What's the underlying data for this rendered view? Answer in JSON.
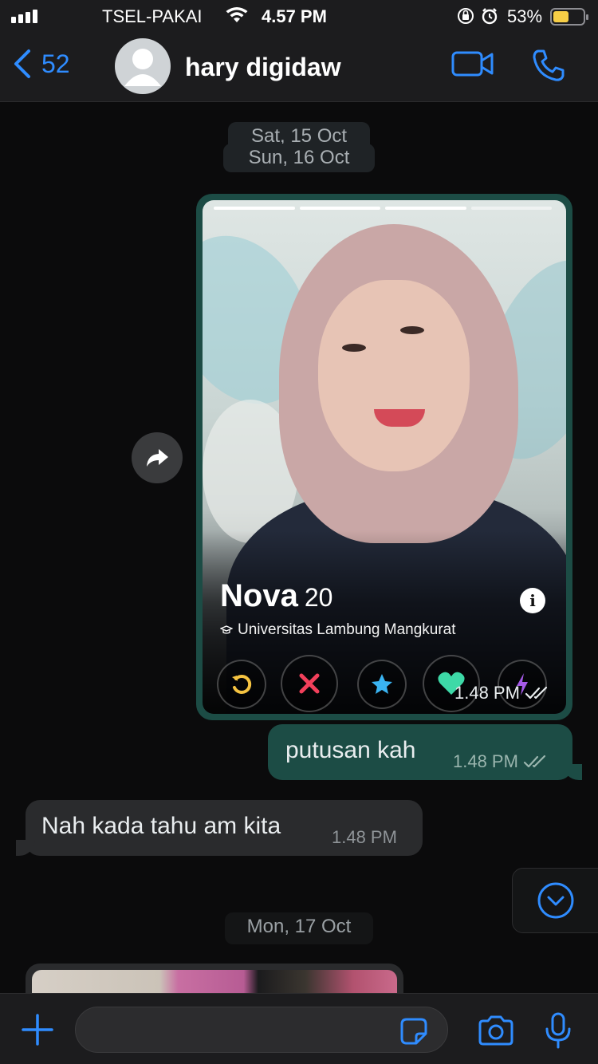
{
  "status_bar": {
    "carrier": "TSEL-PAKAI",
    "time": "4.57 PM",
    "battery_percent": "53%",
    "battery_level": 0.53,
    "icons": [
      "signal-icon",
      "wifi-icon",
      "orientation-lock-icon",
      "alarm-icon",
      "battery-icon"
    ]
  },
  "header": {
    "back_count": "52",
    "contact_name": "hary digidaw",
    "accent_color": "#2f8cff"
  },
  "dates": {
    "first": "Sat, 15 Oct",
    "second": "Sun, 16 Oct",
    "third": "Mon, 17 Oct"
  },
  "image_message": {
    "profile_name": "Nova",
    "profile_age": "20",
    "school": "Universitas Lambung Mangkurat",
    "time": "1.48 PM",
    "actions": [
      "rewind-icon",
      "nope-icon",
      "super-like-icon",
      "like-icon",
      "boost-icon"
    ]
  },
  "messages": [
    {
      "direction": "outgoing",
      "text": "putusan kah",
      "time": "1.48 PM",
      "status": "read"
    },
    {
      "direction": "incoming",
      "text": "Nah kada tahu am kita",
      "time": "1.48 PM"
    }
  ],
  "composer": {
    "value": "",
    "placeholder": ""
  },
  "colors": {
    "outgoing_bubble": "#1c4c45",
    "incoming_bubble": "#2a2b2d",
    "background": "#0b0b0c"
  }
}
